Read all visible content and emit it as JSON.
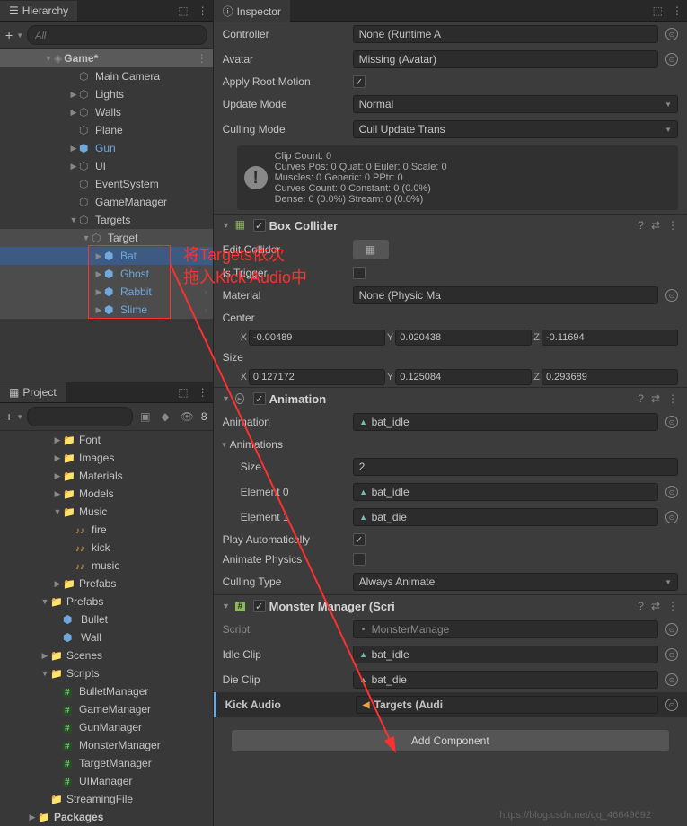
{
  "hierarchy": {
    "title": "Hierarchy",
    "search_placeholder": "All",
    "scene": "Game*",
    "items": [
      {
        "name": "Main Camera",
        "depth": 2,
        "foldout": "none",
        "type": "obj"
      },
      {
        "name": "Lights",
        "depth": 2,
        "foldout": "closed",
        "type": "obj"
      },
      {
        "name": "Walls",
        "depth": 2,
        "foldout": "closed",
        "type": "obj"
      },
      {
        "name": "Plane",
        "depth": 2,
        "foldout": "none",
        "type": "obj"
      },
      {
        "name": "Gun",
        "depth": 2,
        "foldout": "closed",
        "type": "prefab",
        "blue": true
      },
      {
        "name": "UI",
        "depth": 2,
        "foldout": "closed",
        "type": "obj"
      },
      {
        "name": "EventSystem",
        "depth": 2,
        "foldout": "none",
        "type": "obj"
      },
      {
        "name": "GameManager",
        "depth": 2,
        "foldout": "none",
        "type": "obj"
      },
      {
        "name": "Targets",
        "depth": 2,
        "foldout": "open",
        "type": "obj"
      },
      {
        "name": "Target",
        "depth": 3,
        "foldout": "open",
        "type": "obj",
        "highlighted": true
      },
      {
        "name": "Bat",
        "depth": 4,
        "foldout": "closed",
        "type": "prefab",
        "blue": true,
        "arrow": true,
        "selected": true
      },
      {
        "name": "Ghost",
        "depth": 4,
        "foldout": "closed",
        "type": "prefab",
        "blue": true,
        "arrow": true,
        "highlighted": true
      },
      {
        "name": "Rabbit",
        "depth": 4,
        "foldout": "closed",
        "type": "prefab",
        "blue": true,
        "arrow": true,
        "highlighted": true
      },
      {
        "name": "Slime",
        "depth": 4,
        "foldout": "closed",
        "type": "prefab",
        "blue": true,
        "arrow": true,
        "highlighted": true
      }
    ]
  },
  "annotation": {
    "line1": "将Targets依次",
    "line2": "拖入Kick Audio中"
  },
  "project": {
    "title": "Project",
    "slider_count": "8",
    "items": [
      {
        "name": "Font",
        "depth": 2,
        "foldout": "closed",
        "type": "folder"
      },
      {
        "name": "Images",
        "depth": 2,
        "foldout": "closed",
        "type": "folder"
      },
      {
        "name": "Materials",
        "depth": 2,
        "foldout": "closed",
        "type": "folder"
      },
      {
        "name": "Models",
        "depth": 2,
        "foldout": "closed",
        "type": "folder"
      },
      {
        "name": "Music",
        "depth": 2,
        "foldout": "open",
        "type": "folder"
      },
      {
        "name": "fire",
        "depth": 3,
        "foldout": "none",
        "type": "audio"
      },
      {
        "name": "kick",
        "depth": 3,
        "foldout": "none",
        "type": "audio"
      },
      {
        "name": "music",
        "depth": 3,
        "foldout": "none",
        "type": "audio"
      },
      {
        "name": "Prefabs",
        "depth": 2,
        "foldout": "closed",
        "type": "folder"
      },
      {
        "name": "Prefabs",
        "depth": 1,
        "foldout": "open",
        "type": "folder"
      },
      {
        "name": "Bullet",
        "depth": 2,
        "foldout": "none",
        "type": "prefab-asset"
      },
      {
        "name": "Wall",
        "depth": 2,
        "foldout": "none",
        "type": "prefab-asset"
      },
      {
        "name": "Scenes",
        "depth": 1,
        "foldout": "closed",
        "type": "folder"
      },
      {
        "name": "Scripts",
        "depth": 1,
        "foldout": "open",
        "type": "folder"
      },
      {
        "name": "BulletManager",
        "depth": 2,
        "foldout": "none",
        "type": "script"
      },
      {
        "name": "GameManager",
        "depth": 2,
        "foldout": "none",
        "type": "script"
      },
      {
        "name": "GunManager",
        "depth": 2,
        "foldout": "none",
        "type": "script"
      },
      {
        "name": "MonsterManager",
        "depth": 2,
        "foldout": "none",
        "type": "script"
      },
      {
        "name": "TargetManager",
        "depth": 2,
        "foldout": "none",
        "type": "script"
      },
      {
        "name": "UIManager",
        "depth": 2,
        "foldout": "none",
        "type": "script"
      },
      {
        "name": "StreamingFile",
        "depth": 1,
        "foldout": "none",
        "type": "folder"
      },
      {
        "name": "Packages",
        "depth": 0,
        "foldout": "closed",
        "type": "folder",
        "bold": true
      }
    ]
  },
  "inspector": {
    "title": "Inspector",
    "controller_label": "Controller",
    "controller_value": "None (Runtime A",
    "avatar_label": "Avatar",
    "avatar_value": "Missing (Avatar)",
    "apply_root_label": "Apply Root Motion",
    "update_mode_label": "Update Mode",
    "update_mode_value": "Normal",
    "culling_mode_label": "Culling Mode",
    "culling_mode_value": "Cull Update Trans",
    "info_lines": [
      "Clip Count: 0",
      "Curves Pos: 0 Quat: 0 Euler: 0 Scale: 0",
      "Muscles: 0 Generic: 0 PPtr: 0",
      "Curves Count: 0 Constant: 0 (0.0%)",
      "Dense: 0 (0.0%) Stream: 0 (0.0%)"
    ],
    "box_collider": {
      "title": "Box Collider",
      "edit_label": "Edit Collider",
      "is_trigger_label": "Is Trigger",
      "material_label": "Material",
      "material_value": "None (Physic Ma",
      "center_label": "Center",
      "center": {
        "x": "-0.00489",
        "y": "0.020438",
        "z": "-0.11694"
      },
      "size_label": "Size",
      "size": {
        "x": "0.127172",
        "y": "0.125084",
        "z": "0.293689"
      }
    },
    "animation": {
      "title": "Animation",
      "anim_label": "Animation",
      "anim_value": "bat_idle",
      "animations_label": "Animations",
      "size_label": "Size",
      "size_value": "2",
      "el0_label": "Element 0",
      "el0_value": "bat_idle",
      "el1_label": "Element 1",
      "el1_value": "bat_die",
      "play_auto_label": "Play Automatically",
      "animate_physics_label": "Animate Physics",
      "culling_type_label": "Culling Type",
      "culling_type_value": "Always Animate"
    },
    "monster": {
      "title": "Monster Manager (Scri",
      "script_label": "Script",
      "script_value": "MonsterManage",
      "idle_label": "Idle Clip",
      "idle_value": "bat_idle",
      "die_label": "Die Clip",
      "die_value": "bat_die",
      "kick_label": "Kick Audio",
      "kick_value": "Targets (Audi"
    },
    "add_component": "Add Component"
  },
  "watermark": "https://blog.csdn.net/qq_46649692"
}
